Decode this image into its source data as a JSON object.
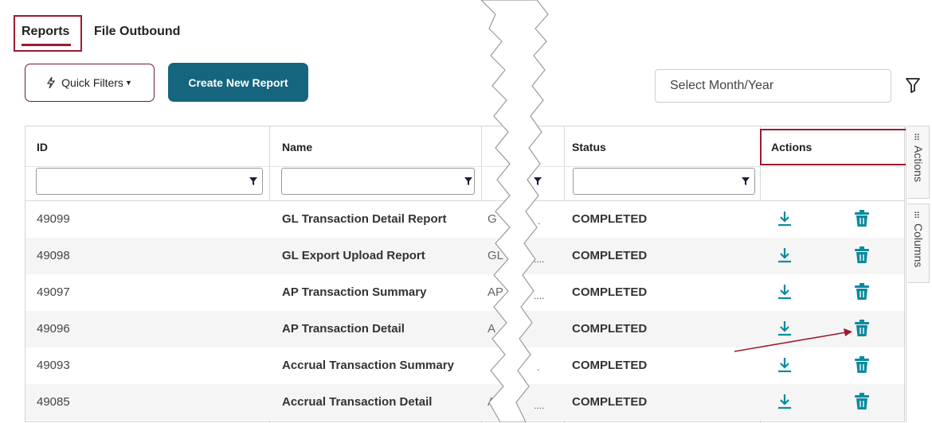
{
  "tabs": [
    {
      "label": "Reports",
      "active": true
    },
    {
      "label": "File Outbound",
      "active": false
    }
  ],
  "toolbar": {
    "quick_filters_label": "Quick Filters",
    "create_report_label": "Create New Report",
    "month_placeholder": "Select Month/Year"
  },
  "grid": {
    "columns": [
      "ID",
      "Name",
      "",
      "Status",
      "Actions"
    ],
    "rows": [
      {
        "id": "49099",
        "name": "GL Transaction Detail Report",
        "partial": "G",
        "status": "COMPLETED"
      },
      {
        "id": "49098",
        "name": "GL Export Upload Report",
        "partial": "GL",
        "status": "COMPLETED"
      },
      {
        "id": "49097",
        "name": "AP Transaction Summary",
        "partial": "AP",
        "status": "COMPLETED"
      },
      {
        "id": "49096",
        "name": "AP Transaction Detail",
        "partial": "A",
        "status": "COMPLETED"
      },
      {
        "id": "49093",
        "name": "Accrual Transaction Summary",
        "partial": "",
        "status": "COMPLETED"
      },
      {
        "id": "49085",
        "name": "Accrual Transaction Detail",
        "partial": "A",
        "status": "COMPLETED"
      }
    ]
  },
  "side_panel": {
    "actions_label": "Actions",
    "columns_label": "Columns"
  },
  "colors": {
    "accent": "#9b1b30",
    "primary_button": "#16657e",
    "icon_teal": "#0a8a9e"
  }
}
